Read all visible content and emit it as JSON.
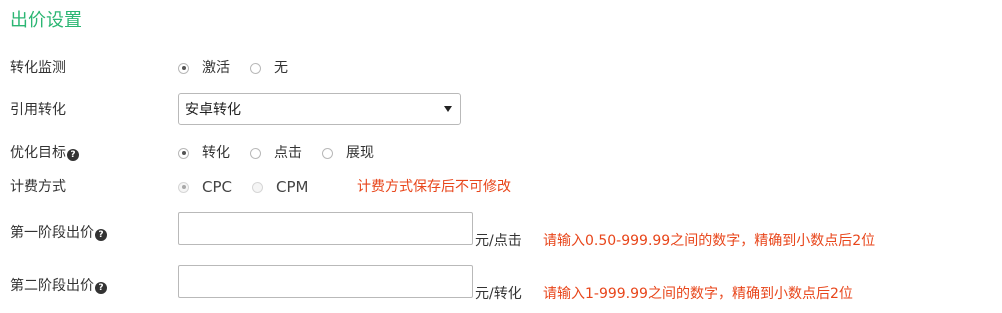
{
  "section": {
    "title": "出价设置"
  },
  "conversion_monitor": {
    "label": "转化监测",
    "options": [
      {
        "label": "激活",
        "checked": true
      },
      {
        "label": "无",
        "checked": false
      }
    ]
  },
  "ref_conversion": {
    "label": "引用转化",
    "selected": "安卓转化"
  },
  "optimize_target": {
    "label": "优化目标",
    "options": [
      {
        "label": "转化",
        "checked": true
      },
      {
        "label": "点击",
        "checked": false
      },
      {
        "label": "展现",
        "checked": false
      }
    ]
  },
  "billing": {
    "label": "计费方式",
    "options": [
      {
        "label": "CPC",
        "checked": true,
        "disabled": true
      },
      {
        "label": "CPM",
        "checked": false,
        "disabled": true
      }
    ],
    "note": "计费方式保存后不可修改"
  },
  "stage1": {
    "label": "第一阶段出价",
    "value": "",
    "unit": "元/点击",
    "hint": "请输入0.50-999.99之间的数字，精确到小数点后2位"
  },
  "stage2": {
    "label": "第二阶段出价",
    "value": "",
    "unit": "元/转化",
    "hint": "请输入1-999.99之间的数字，精确到小数点后2位"
  },
  "colors": {
    "title_green": "#2bb673",
    "warning_red": "#e8461b",
    "text": "#333333",
    "border": "#b9b9b9"
  },
  "icons": [
    "question-circle-icon",
    "chevron-down-icon",
    "radio-icon"
  ]
}
